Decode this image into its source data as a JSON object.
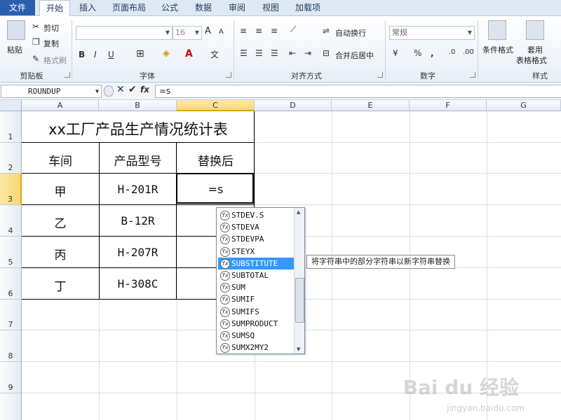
{
  "tabs": [
    "文件",
    "开始",
    "插入",
    "页面布局",
    "公式",
    "数据",
    "审阅",
    "视图",
    "加载项"
  ],
  "ribbon": {
    "clipboard": {
      "paste": "粘贴",
      "cut": "剪切",
      "copy": "复制",
      "format_painter": "格式刷",
      "label": "剪贴板"
    },
    "font": {
      "size": "16",
      "bold": "B",
      "italic": "I",
      "underline": "U",
      "grow": "A",
      "shrink": "A",
      "label": "字体"
    },
    "alignment": {
      "wrap": "自动换行",
      "merge": "合并后居中",
      "label": "对齐方式"
    },
    "number": {
      "format": "常规",
      "percent": "%",
      "comma": ",",
      "label": "数字"
    },
    "styles": {
      "conditional": "条件格式",
      "table_line1": "套用",
      "table_line2": "表格格式",
      "label": "样式"
    }
  },
  "formula_bar": {
    "name_box": "ROUNDUP",
    "formula": "=s",
    "fx": "fx"
  },
  "columns": [
    "A",
    "B",
    "C",
    "D",
    "E",
    "F",
    "G"
  ],
  "rows": [
    "1",
    "2",
    "3",
    "4",
    "5",
    "6",
    "7",
    "8",
    "9"
  ],
  "sheet": {
    "title": "xx工厂产品生产情况统计表",
    "headers": [
      "车间",
      "产品型号",
      "替换后"
    ],
    "data": [
      [
        "甲",
        "H-201R",
        "=s"
      ],
      [
        "乙",
        "B-12R",
        ""
      ],
      [
        "丙",
        "H-207R",
        ""
      ],
      [
        "丁",
        "H-308C",
        ""
      ]
    ]
  },
  "autocomplete": {
    "items": [
      "STDEV.S",
      "STDEVA",
      "STDEVPA",
      "STEYX",
      "SUBSTITUTE",
      "SUBTOTAL",
      "SUM",
      "SUMIF",
      "SUMIFS",
      "SUMPRODUCT",
      "SUMSQ",
      "SUMX2MY2"
    ],
    "selected_index": 4,
    "tooltip": "将字符串中的部分字符串以新字符串替换"
  },
  "watermark": {
    "brand": "Bai du 经验",
    "url": "jingyan.baidu.com"
  },
  "colors": {
    "file_tab": "#2a5fad",
    "selection": "#3399ff",
    "header_selected": "#f9d970"
  }
}
